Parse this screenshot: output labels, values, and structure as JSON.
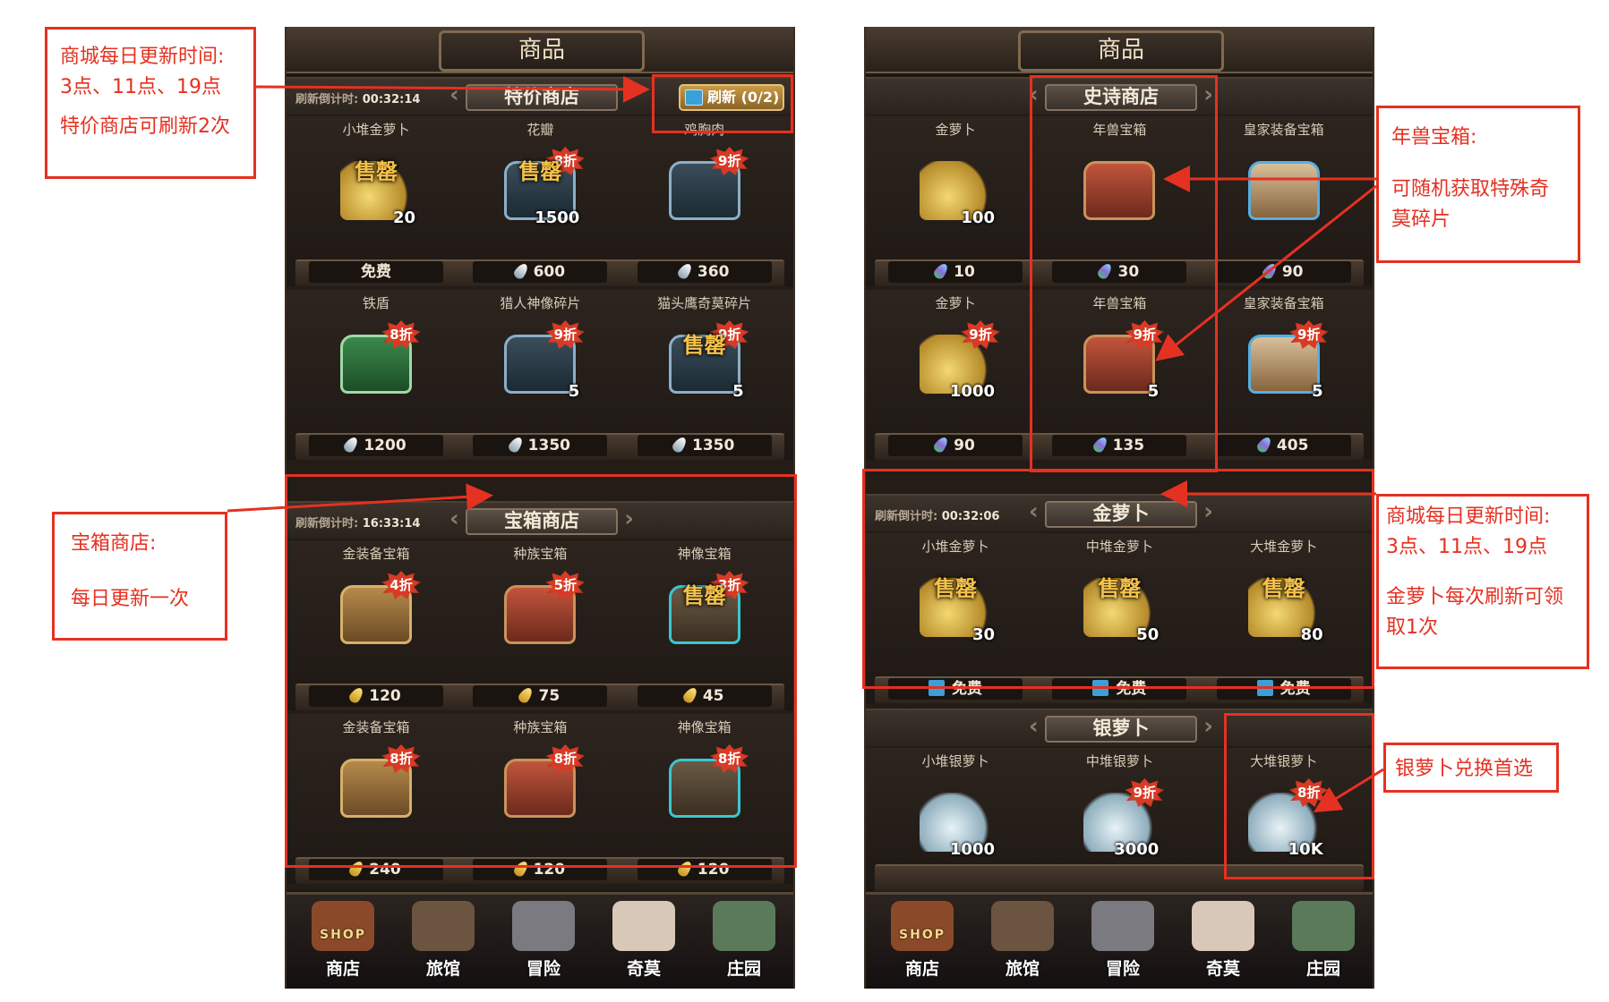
{
  "left": {
    "header_title": "商品",
    "special_shop": {
      "countdown_label": "刷新倒计时:",
      "countdown_value": "00:32:14",
      "title": "特价商店",
      "refresh_button": "刷新 (0/2)",
      "rows": [
        [
          {
            "name": "小堆金萝卜",
            "icon": "gold-carrot-pile-icon",
            "qty": "20",
            "sold_out": "售罄",
            "discount": "",
            "price": "免费",
            "currency": "none"
          },
          {
            "name": "花瓣",
            "icon": "petal-icon",
            "qty": "1500",
            "sold_out": "售罄",
            "discount": "8折",
            "price": "600",
            "currency": "silver"
          },
          {
            "name": "鸡胸肉",
            "icon": "chicken-breast-icon",
            "qty": "",
            "sold_out": "",
            "discount": "9折",
            "price": "360",
            "currency": "silver"
          }
        ],
        [
          {
            "name": "铁盾",
            "icon": "iron-shield-icon",
            "qty": "",
            "sold_out": "",
            "discount": "8折",
            "price": "1200",
            "currency": "silver"
          },
          {
            "name": "猎人神像碎片",
            "icon": "hunter-statue-shard-icon",
            "qty": "5",
            "sold_out": "",
            "discount": "9折",
            "price": "1350",
            "currency": "silver"
          },
          {
            "name": "猫头鹰奇莫碎片",
            "icon": "owl-qimo-shard-icon",
            "qty": "5",
            "sold_out": "售罄",
            "discount": "9折",
            "price": "1350",
            "currency": "silver"
          }
        ]
      ]
    },
    "chest_shop": {
      "countdown_label": "刷新倒计时:",
      "countdown_value": "16:33:14",
      "title": "宝箱商店",
      "rows": [
        [
          {
            "name": "金装备宝箱",
            "icon": "gold-equipment-chest-icon",
            "qty": "",
            "sold_out": "",
            "discount": "4折",
            "price": "120",
            "currency": "gold"
          },
          {
            "name": "种族宝箱",
            "icon": "race-chest-icon",
            "qty": "",
            "sold_out": "",
            "discount": "5折",
            "price": "75",
            "currency": "gold"
          },
          {
            "name": "神像宝箱",
            "icon": "statue-chest-icon",
            "qty": "",
            "sold_out": "售罄",
            "discount": "3折",
            "price": "45",
            "currency": "gold"
          }
        ],
        [
          {
            "name": "金装备宝箱",
            "icon": "gold-equipment-chest-icon",
            "qty": "",
            "sold_out": "",
            "discount": "8折",
            "price": "240",
            "currency": "gold"
          },
          {
            "name": "种族宝箱",
            "icon": "race-chest-icon",
            "qty": "",
            "sold_out": "",
            "discount": "8折",
            "price": "120",
            "currency": "gold"
          },
          {
            "name": "神像宝箱",
            "icon": "statue-chest-icon",
            "qty": "",
            "sold_out": "",
            "discount": "8折",
            "price": "120",
            "currency": "gold"
          }
        ]
      ]
    }
  },
  "right": {
    "header_title": "商品",
    "epic_shop": {
      "title": "史诗商店",
      "rows": [
        [
          {
            "name": "金萝卜",
            "icon": "gold-carrot-icon",
            "qty": "100",
            "sold_out": "",
            "discount": "",
            "price": "10",
            "currency": "rainbow"
          },
          {
            "name": "年兽宝箱",
            "icon": "nian-beast-chest-icon",
            "qty": "",
            "sold_out": "",
            "discount": "",
            "price": "30",
            "currency": "rainbow"
          },
          {
            "name": "皇家装备宝箱",
            "icon": "royal-equipment-chest-icon",
            "qty": "",
            "sold_out": "",
            "discount": "",
            "price": "90",
            "currency": "rainbow"
          }
        ],
        [
          {
            "name": "金萝卜",
            "icon": "gold-carrot-icon",
            "qty": "1000",
            "sold_out": "",
            "discount": "9折",
            "price": "90",
            "currency": "rainbow"
          },
          {
            "name": "年兽宝箱",
            "icon": "nian-beast-chest-icon",
            "qty": "5",
            "sold_out": "",
            "discount": "9折",
            "price": "135",
            "currency": "rainbow"
          },
          {
            "name": "皇家装备宝箱",
            "icon": "royal-equipment-chest-icon",
            "qty": "5",
            "sold_out": "",
            "discount": "9折",
            "price": "405",
            "currency": "rainbow"
          }
        ]
      ]
    },
    "gold_carrot": {
      "countdown_label": "刷新倒计时:",
      "countdown_value": "00:32:06",
      "title": "金萝卜",
      "items": [
        {
          "name": "小堆金萝卜",
          "icon": "gold-carrot-pile-icon",
          "qty": "30",
          "sold_out": "售罄",
          "discount": "",
          "price": "免费",
          "currency": "ad"
        },
        {
          "name": "中堆金萝卜",
          "icon": "gold-carrot-pile-icon",
          "qty": "50",
          "sold_out": "售罄",
          "discount": "",
          "price": "免费",
          "currency": "ad"
        },
        {
          "name": "大堆金萝卜",
          "icon": "gold-carrot-pile-icon",
          "qty": "80",
          "sold_out": "售罄",
          "discount": "",
          "price": "免费",
          "currency": "ad"
        }
      ]
    },
    "silver_carrot": {
      "title": "银萝卜",
      "items": [
        {
          "name": "小堆银萝卜",
          "icon": "silver-carrot-pile-icon",
          "qty": "1000",
          "discount": ""
        },
        {
          "name": "中堆银萝卜",
          "icon": "silver-carrot-pile-icon",
          "qty": "3000",
          "discount": "9折"
        },
        {
          "name": "大堆银萝卜",
          "icon": "silver-carrot-pile-icon",
          "qty": "10K",
          "discount": "8折"
        }
      ]
    }
  },
  "nav": [
    {
      "label": "商店",
      "icon": "shop-icon",
      "sign": "SHOP"
    },
    {
      "label": "旅馆",
      "icon": "inn-icon"
    },
    {
      "label": "冒险",
      "icon": "crossed-swords-icon"
    },
    {
      "label": "奇莫",
      "icon": "qimo-icon"
    },
    {
      "label": "庄园",
      "icon": "manor-icon"
    }
  ],
  "annotations": {
    "left_top": [
      "商城每日更新时间:",
      "3点、11点、19点",
      "",
      "特价商店可刷新2次"
    ],
    "left_chest": [
      "宝箱商店:",
      "",
      "每日更新一次"
    ],
    "right_nian": [
      "年兽宝箱:",
      "",
      "可随机获取特殊奇",
      "莫碎片"
    ],
    "right_gold": [
      "商城每日更新时间:",
      "3点、11点、19点",
      "",
      "金萝卜每次刷新可领",
      "取1次"
    ],
    "right_silver": [
      "银萝卜兑换首选"
    ]
  },
  "colors": {
    "annotation_red": "#e53121",
    "discount_red": "#d93a25",
    "panel_dark": "#1d1713"
  }
}
